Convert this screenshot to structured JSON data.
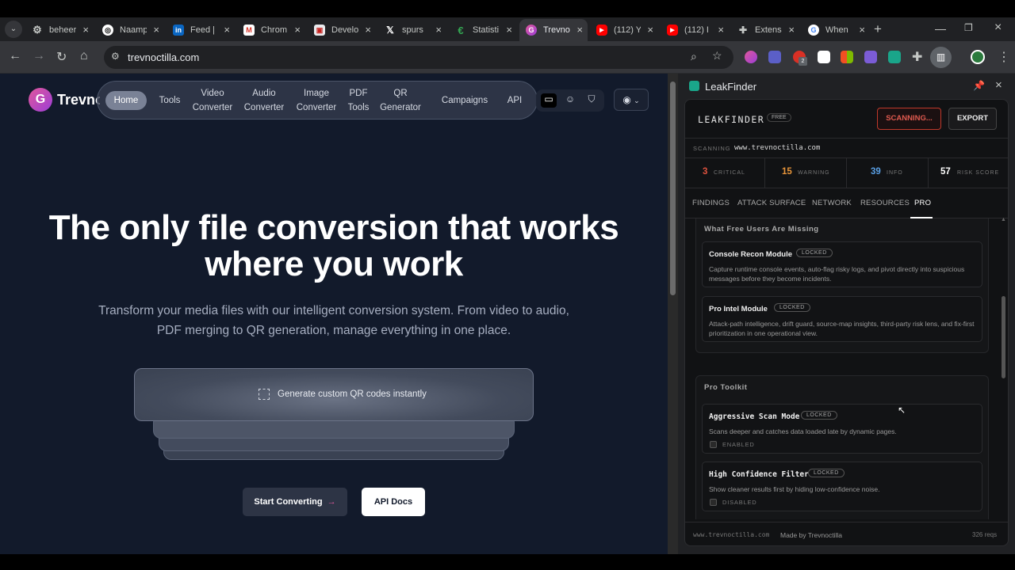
{
  "browser": {
    "tabs": [
      {
        "label": "beheer",
        "icon": "gear"
      },
      {
        "label": "Naamp",
        "icon": "chatgpt"
      },
      {
        "label": "Feed |",
        "icon": "linkedin"
      },
      {
        "label": "Chrom",
        "icon": "gmail"
      },
      {
        "label": "Develo",
        "icon": "docs"
      },
      {
        "label": "spurs",
        "icon": "x"
      },
      {
        "label": "Statisti",
        "icon": "stats"
      },
      {
        "label": "Trevno",
        "icon": "trevnoctilla",
        "active": true
      },
      {
        "label": "(112) Y",
        "icon": "youtube"
      },
      {
        "label": "(112) I",
        "icon": "youtube"
      },
      {
        "label": "Extens",
        "icon": "puzzle"
      },
      {
        "label": "When",
        "icon": "google"
      }
    ],
    "url": "trevnoctilla.com",
    "ext_badge": "2"
  },
  "site": {
    "brand": "Trevnoctilla",
    "nav": {
      "home": "Home",
      "tools": "Tools",
      "video_1": "Video",
      "video_2": "Converter",
      "audio_1": "Audio",
      "audio_2": "Converter",
      "image_1": "Image",
      "image_2": "Converter",
      "pdf_1": "PDF",
      "pdf_2": "Tools",
      "qr_1": "QR",
      "qr_2": "Generator",
      "campaigns": "Campaigns",
      "api": "API"
    },
    "hero_line1": "The only file conversion that works",
    "hero_line2": "where you work",
    "sub_line1": "Transform your media files with our intelligent conversion system. From video to audio,",
    "sub_line2": "PDF merging to QR generation, manage everything in one place.",
    "qr_card": "Generate custom QR codes instantly",
    "btn_start": "Start Converting",
    "btn_api": "API Docs"
  },
  "panel": {
    "title": "LeakFinder",
    "brand": "LEAKFINDER",
    "free_badge": "FREE",
    "btn_scan": "SCANNING...",
    "btn_export": "EXPORT",
    "scanning_label": "SCANNING",
    "scanning_url": "www.trevnoctilla.com",
    "stats": [
      {
        "n": "3",
        "label": "CRITICAL",
        "color": "#e0533f"
      },
      {
        "n": "15",
        "label": "WARNING",
        "color": "#e8953a"
      },
      {
        "n": "39",
        "label": "INFO",
        "color": "#5aa0e6"
      },
      {
        "n": "57",
        "label": "RISK SCORE",
        "color": "#ffffff"
      }
    ],
    "tabs": [
      "FINDINGS",
      "ATTACK SURFACE",
      "NETWORK",
      "RESOURCES",
      "PRO"
    ],
    "section1": {
      "heading": "What Free Users Are Missing",
      "cards": [
        {
          "title": "Console Recon Module",
          "badge": "LOCKED",
          "desc": "Capture runtime console events, auto-flag risky logs, and pivot directly into suspicious messages before they become incidents."
        },
        {
          "title": "Pro Intel Module",
          "badge": "LOCKED",
          "desc": "Attack-path intelligence, drift guard, source-map insights, third-party risk lens, and fix-first prioritization in one operational view."
        }
      ]
    },
    "section2": {
      "heading": "Pro Toolkit",
      "cards": [
        {
          "title": "Aggressive Scan Mode",
          "badge": "LOCKED",
          "desc": "Scans deeper and catches data loaded late by dynamic pages.",
          "state": "ENABLED"
        },
        {
          "title": "High Confidence Filter",
          "badge": "LOCKED",
          "desc": "Show cleaner results first by hiding low-confidence noise.",
          "state": "DISABLED"
        }
      ]
    },
    "footer": {
      "domain": "www.trevnoctilla.com",
      "made_by": "Made by Trevnoctilla",
      "reqs": "326 reqs"
    }
  }
}
